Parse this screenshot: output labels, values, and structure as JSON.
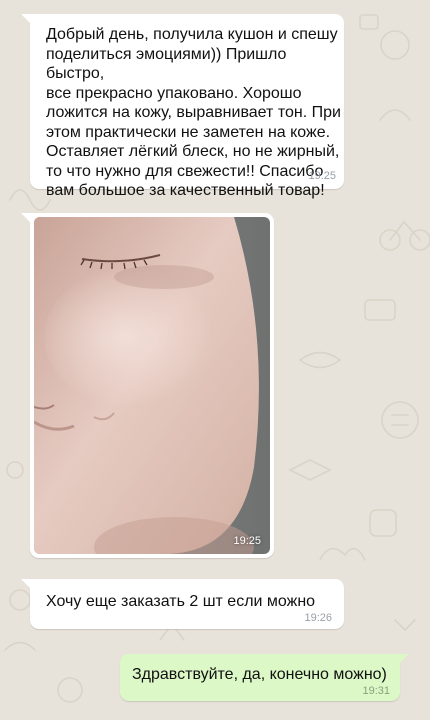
{
  "chat": {
    "messages": [
      {
        "direction": "incoming",
        "text": "Добрый день, получила кушон и спешу\nподелиться эмоциями)) Пришло быстро,\nвсе прекрасно упаковано. Хорошо\nложится на кожу, выравнивает тон. При\nэтом практически не заметен на коже.\nОставляет лёгкий блеск, но не жирный,\nто что нужно для свежести!! Спасибо\nвам большое за качественный товар!",
        "time": "19:25"
      },
      {
        "direction": "incoming",
        "type": "photo",
        "time": "19:25"
      },
      {
        "direction": "incoming",
        "text": "Хочу еще заказать 2 шт если можно",
        "time": "19:26"
      },
      {
        "direction": "outgoing",
        "text": "Здравствуйте, да, конечно можно)",
        "time": "19:31"
      }
    ]
  },
  "colors": {
    "wallpaper": "#e8e3da",
    "incoming_bubble": "#ffffff",
    "outgoing_bubble": "#dcf8c6",
    "timestamp": "#9aa0a6"
  }
}
